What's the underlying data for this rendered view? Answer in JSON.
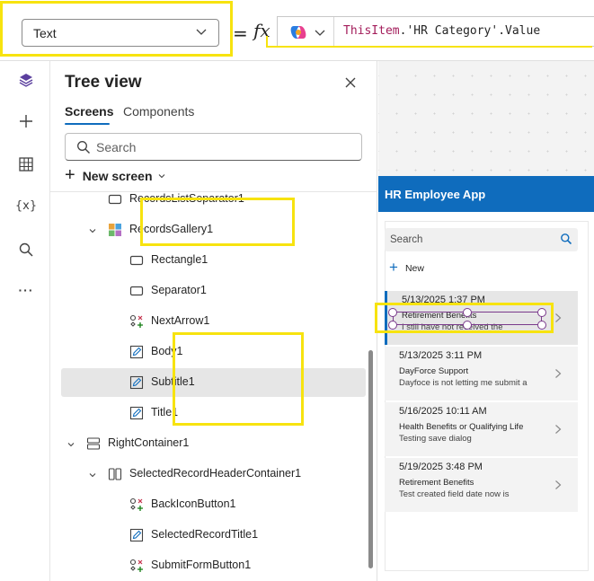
{
  "formula_bar": {
    "property": "Text",
    "equals": "=",
    "fx": "fx",
    "formula_keyword": "ThisItem",
    "formula_rest": ".'HR Category'.Value"
  },
  "rail": {
    "items": [
      "layers-icon",
      "plus-icon",
      "table-icon",
      "variables-icon",
      "search-icon",
      "more-icon"
    ],
    "variables_text": "{x}",
    "more_text": "···"
  },
  "tree": {
    "title": "Tree view",
    "tabs": [
      "Screens",
      "Components"
    ],
    "search_placeholder": "Search",
    "new_screen_label": "New screen",
    "rows": [
      {
        "label": "RecordsListSeparator1",
        "icon": "rectangle-icon",
        "indent": 2,
        "caret": false
      },
      {
        "label": "RecordsGallery1",
        "icon": "gallery-icon",
        "indent": 2,
        "caret": true
      },
      {
        "label": "Rectangle1",
        "icon": "rectangle-icon",
        "indent": 3,
        "caret": false
      },
      {
        "label": "Separator1",
        "icon": "rectangle-icon",
        "indent": 3,
        "caret": false
      },
      {
        "label": "NextArrow1",
        "icon": "icon-control-icon",
        "indent": 3,
        "caret": false
      },
      {
        "label": "Body1",
        "icon": "edit-icon",
        "indent": 3,
        "caret": false
      },
      {
        "label": "Subtitle1",
        "icon": "edit-icon",
        "indent": 3,
        "caret": false,
        "selected": true
      },
      {
        "label": "Title1",
        "icon": "edit-icon",
        "indent": 3,
        "caret": false
      },
      {
        "label": "RightContainer1",
        "icon": "vertical-container-icon",
        "indent": 1,
        "caret": true
      },
      {
        "label": "SelectedRecordHeaderContainer1",
        "icon": "horizontal-container-icon",
        "indent": 2,
        "caret": true
      },
      {
        "label": "BackIconButton1",
        "icon": "icon-control-icon",
        "indent": 3,
        "caret": false
      },
      {
        "label": "SelectedRecordTitle1",
        "icon": "edit-icon",
        "indent": 3,
        "caret": false
      },
      {
        "label": "SubmitFormButton1",
        "icon": "icon-control-icon",
        "indent": 3,
        "caret": false
      }
    ]
  },
  "app": {
    "header_title": "HR Employee App",
    "search_placeholder": "Search",
    "new_label": "New",
    "accent": "#0f6cbd",
    "items": [
      {
        "date": "5/13/2025 1:37 PM",
        "category": "Retirement Benefits",
        "body": "I still have not received the",
        "selected": true
      },
      {
        "date": "5/13/2025 3:11 PM",
        "category": "DayForce Support",
        "body": "Dayfoce is not letting me submit a"
      },
      {
        "date": "5/16/2025 10:11 AM",
        "category": "Health Benefits or Qualifying Life",
        "body": "Testing save dialog"
      },
      {
        "date": "5/19/2025 3:48 PM",
        "category": "Retirement Benefits",
        "body": "Test created field date now is"
      }
    ]
  },
  "colors": {
    "annotation": "#f7e30f",
    "selection": "#7a3a8c"
  }
}
